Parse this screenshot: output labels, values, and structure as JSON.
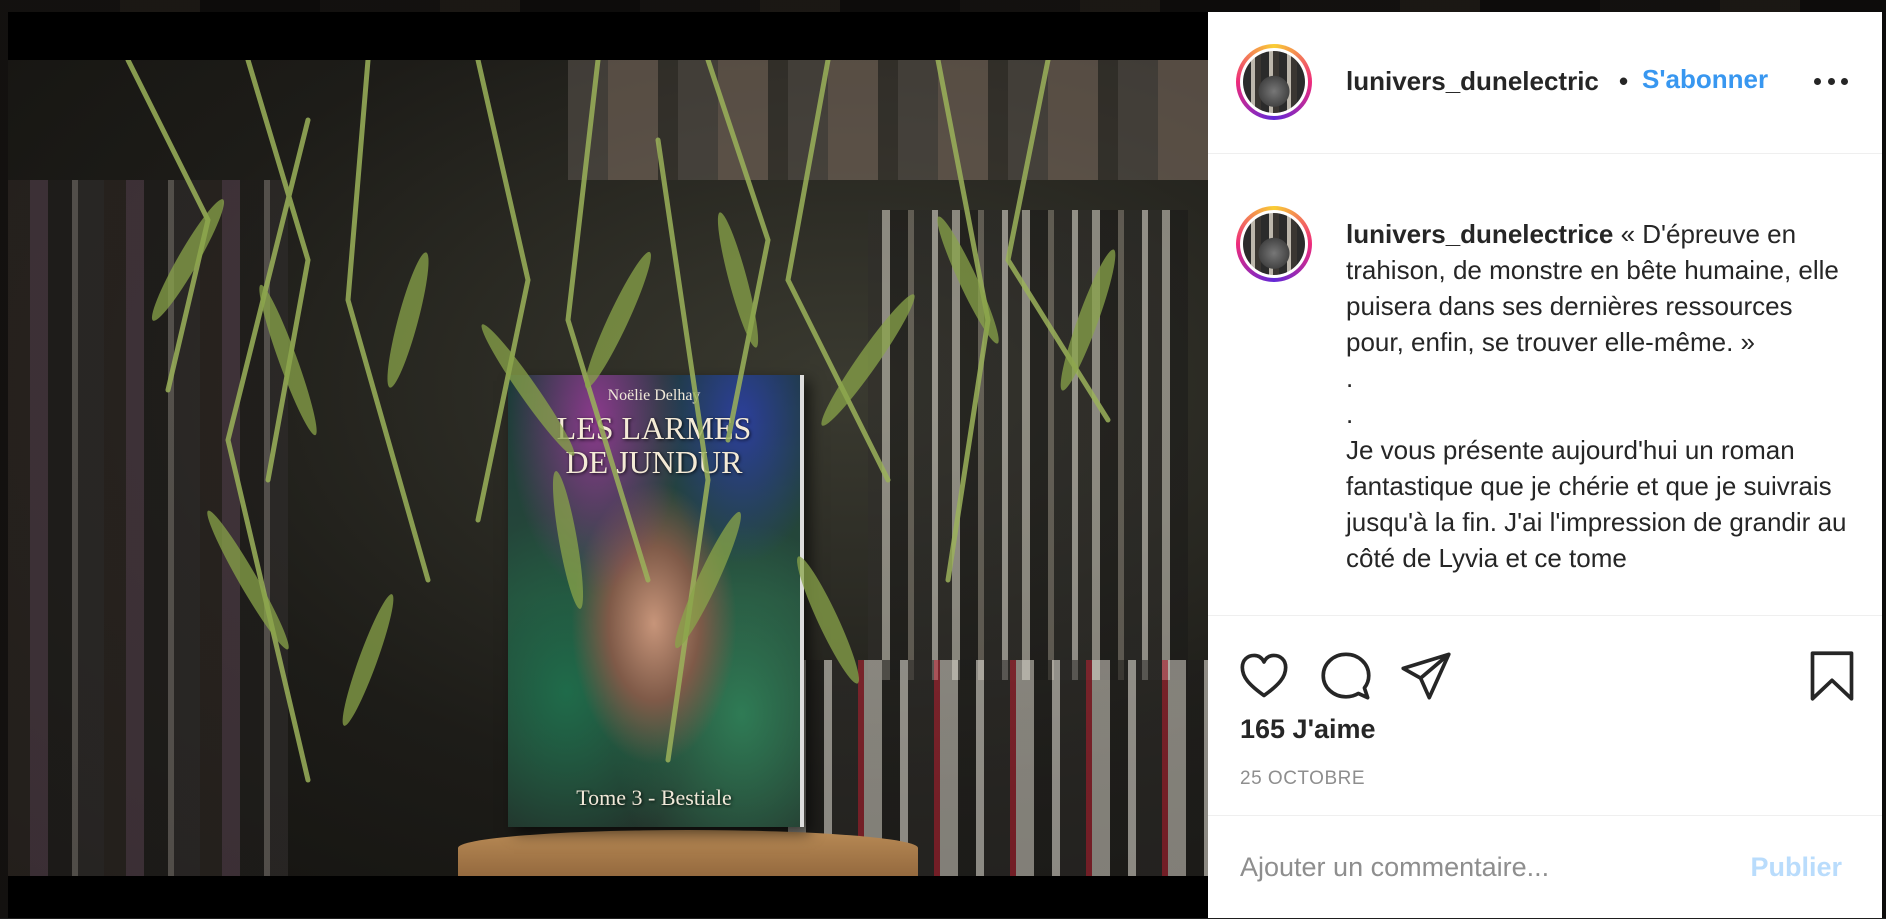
{
  "post": {
    "image": {
      "book_author": "Noëlie Delhay",
      "book_title_line1": "LES LARMES",
      "book_title_line2": "DE JUNDUR",
      "book_subtitle": "Tome 3 - Bestiale"
    },
    "header": {
      "username": "lunivers_dunelectric",
      "separator": "•",
      "follow_label": "S'abonner",
      "more_icon": "more-horizontal-icon"
    },
    "caption": {
      "username": "lunivers_dunelectrice",
      "text": " « D'épreuve en trahison, de monstre en bête humaine, elle puisera dans ses dernières ressources pour, enfin, se trouver elle-même. »\n.\n.\nJe vous présente aujourd'hui un roman fantastique que je chérie et que je suivrais jusqu'à la fin. J'ai l'impression de grandir au côté de Lyvia et ce tome"
    },
    "actions": {
      "like_icon": "heart-icon",
      "comment_icon": "comment-bubble-icon",
      "share_icon": "paper-plane-icon",
      "save_icon": "bookmark-icon"
    },
    "likes_label": "165 J'aime",
    "date_label": "25 OCTOBRE",
    "comment": {
      "placeholder": "Ajouter un commentaire...",
      "publish_label": "Publier"
    },
    "colors": {
      "link_blue": "#3897f0",
      "publish_disabled": "#b9dcfc",
      "text": "#262626",
      "muted": "#8e8e8e"
    }
  }
}
